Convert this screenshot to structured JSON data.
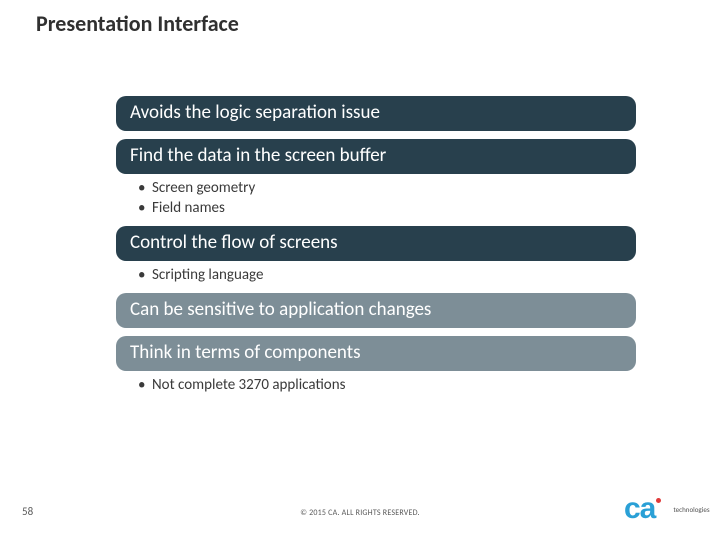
{
  "title": "Presentation Interface",
  "bars": {
    "b1": "Avoids the logic separation issue",
    "b2": "Find the data in the screen buffer",
    "b3": "Control the flow of screens",
    "b4": "Can be sensitive to application changes",
    "b5": "Think in terms of components"
  },
  "subs": {
    "s2a": "Screen geometry",
    "s2b": "Field names",
    "s3a": "Scripting language",
    "s5a": "Not complete 3270 applications"
  },
  "footer": {
    "page": "58",
    "copyright": "© 2015 CA. ALL RIGHTS RESERVED.",
    "logo_main": "ca",
    "logo_sub": "technologies"
  }
}
